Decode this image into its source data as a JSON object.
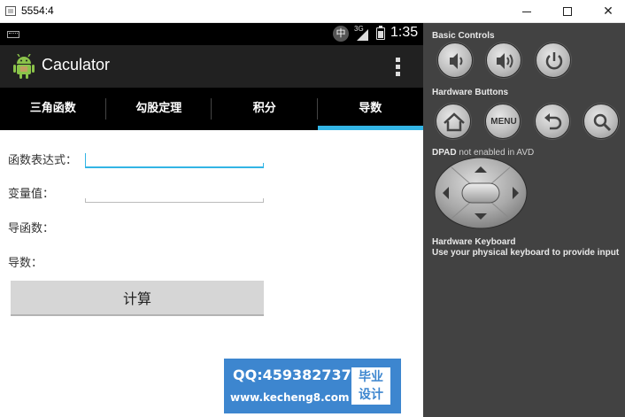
{
  "window": {
    "title": "5554:4",
    "minimize_glyph": "",
    "maximize_glyph": "",
    "close_glyph": "✕"
  },
  "statusbar": {
    "ime": "中",
    "network": "3G",
    "clock": "1:35"
  },
  "actionbar": {
    "title": "Caculator"
  },
  "tabs": [
    {
      "label": "三角函数",
      "selected": false
    },
    {
      "label": "勾股定理",
      "selected": false
    },
    {
      "label": "积分",
      "selected": false
    },
    {
      "label": "导数",
      "selected": true
    }
  ],
  "form": {
    "expression_label": "函数表达式：",
    "expression_value": "",
    "variable_label": "变量值：",
    "variable_value": "",
    "derivative_fn_label": "导函数：",
    "derivative_label": "导数：",
    "calculate_button": "计算"
  },
  "watermark": {
    "qq": "QQ:459382737",
    "site": "www.kecheng8.com",
    "badge_line1": "毕业",
    "badge_line2": "设计"
  },
  "panel": {
    "basic_controls": "Basic Controls",
    "hardware_buttons": "Hardware Buttons",
    "menu_label": "MENU",
    "dpad_title": "DPAD",
    "dpad_note": "not enabled in AVD",
    "keyboard_title": "Hardware Keyboard",
    "keyboard_note": "Use your physical keyboard to provide input",
    "icons": [
      "volume-down-icon",
      "volume-up-icon",
      "power-icon",
      "home-icon",
      "menu-icon",
      "back-icon",
      "search-icon"
    ]
  },
  "colors": {
    "accent": "#33b5e5",
    "panel_bg": "#424242",
    "actionbar_bg": "#212121",
    "watermark_bg": "#3d86cf"
  }
}
